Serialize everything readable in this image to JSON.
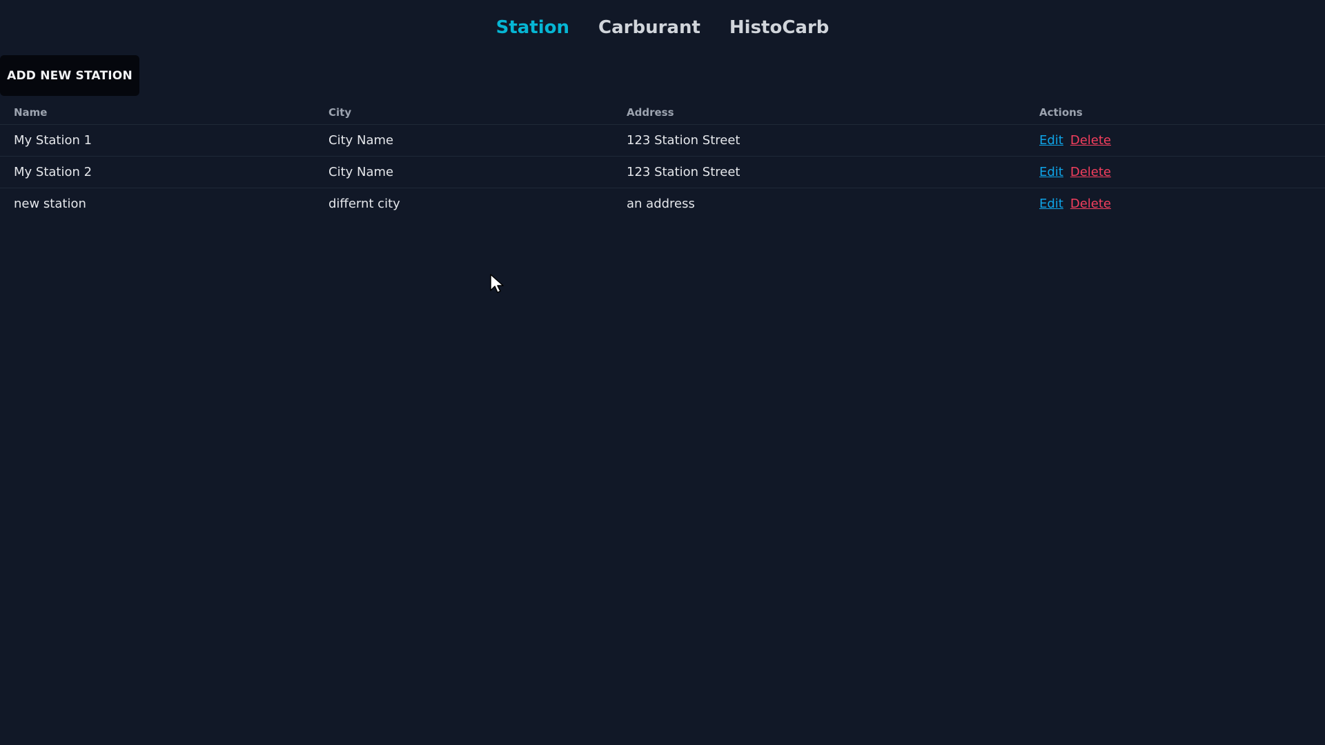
{
  "nav": {
    "items": [
      {
        "label": "Station",
        "active": true
      },
      {
        "label": "Carburant",
        "active": false
      },
      {
        "label": "HistoCarb",
        "active": false
      }
    ],
    "active_color": "#06b6d4"
  },
  "toolbar": {
    "add_label": "ADD NEW STATION"
  },
  "table": {
    "headers": {
      "name": "Name",
      "city": "City",
      "address": "Address",
      "actions": "Actions"
    },
    "rows": [
      {
        "name": "My Station 1",
        "city": "City Name",
        "address": "123 Station Street",
        "edit": "Edit",
        "delete": "Delete"
      },
      {
        "name": "My Station 2",
        "city": "City Name",
        "address": "123 Station Street",
        "edit": "Edit",
        "delete": "Delete"
      },
      {
        "name": "new station",
        "city": "differnt city",
        "address": "an address",
        "edit": "Edit",
        "delete": "Delete"
      }
    ]
  },
  "colors": {
    "background": "#111827",
    "edit_link": "#0ea5e9",
    "delete_link": "#f43f5e"
  },
  "icons": {
    "cursor": "mouse-pointer-icon"
  }
}
